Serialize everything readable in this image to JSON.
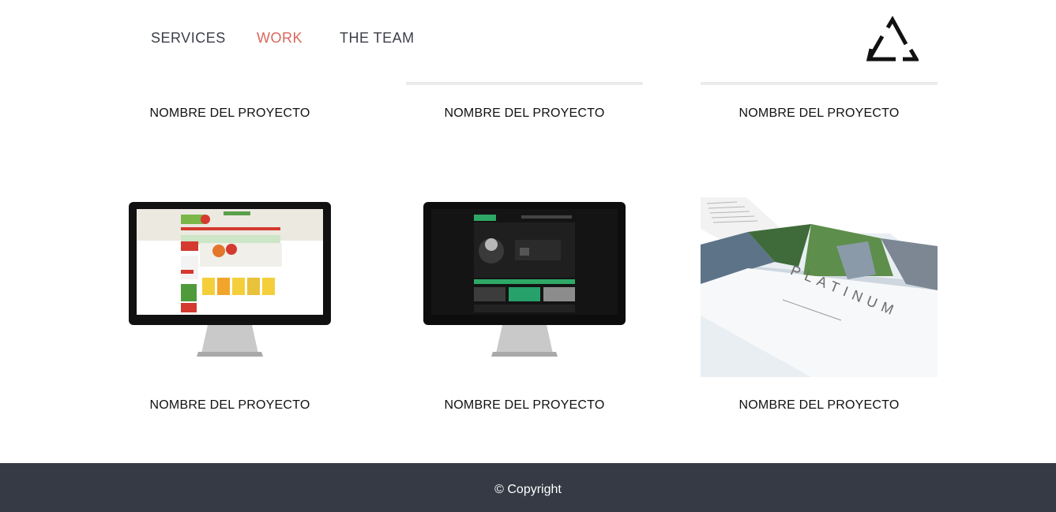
{
  "nav": {
    "items": [
      {
        "label": "SERVICES"
      },
      {
        "label": "WORK"
      },
      {
        "label": "THE TEAM"
      }
    ],
    "active": "WORK",
    "active_color": "#d9675d",
    "text_color": "#3b3f48"
  },
  "logo": {
    "icon": "triangle-logo-icon"
  },
  "projects": [
    {
      "title": "NOMBRE DEL PROYECTO"
    },
    {
      "title": "NOMBRE DEL PROYECTO"
    },
    {
      "title": "NOMBRE DEL PROYECTO"
    },
    {
      "title": "NOMBRE DEL PROYECTO",
      "image": "monitor-shop-site"
    },
    {
      "title": "NOMBRE DEL PROYECTO",
      "image": "monitor-dark-site"
    },
    {
      "title": "NOMBRE DEL PROYECTO",
      "image": "platinum-brochure"
    }
  ],
  "brochure": {
    "word": "PLATINUM"
  },
  "footer": {
    "text": "© Copyright",
    "bg": "#353a45"
  }
}
